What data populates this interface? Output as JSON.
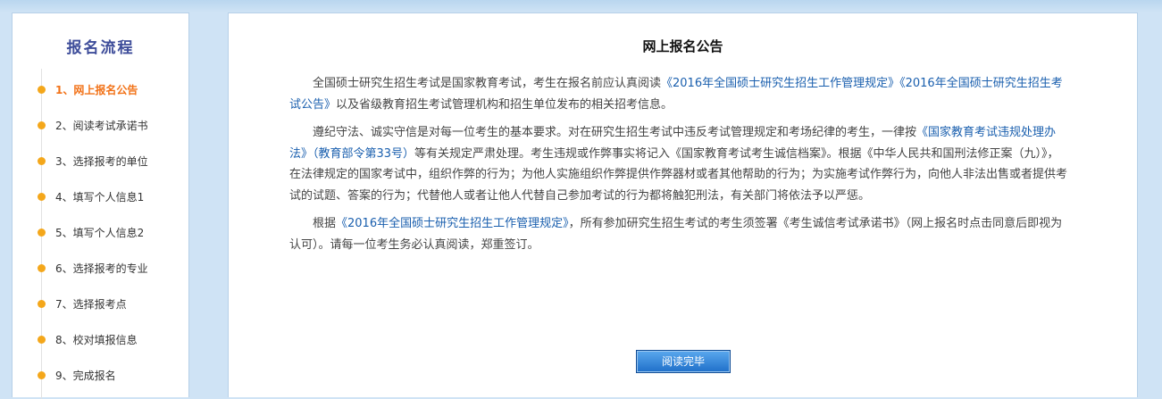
{
  "sidebar": {
    "title": "报名流程",
    "steps": [
      {
        "label": "1、网上报名公告",
        "active": true
      },
      {
        "label": "2、阅读考试承诺书",
        "active": false
      },
      {
        "label": "3、选择报考的单位",
        "active": false
      },
      {
        "label": "4、填写个人信息1",
        "active": false
      },
      {
        "label": "5、填写个人信息2",
        "active": false
      },
      {
        "label": "6、选择报考的专业",
        "active": false
      },
      {
        "label": "7、选择报考点",
        "active": false
      },
      {
        "label": "8、校对填报信息",
        "active": false
      },
      {
        "label": "9、完成报名",
        "active": false
      }
    ]
  },
  "notice": {
    "title": "网上报名公告",
    "p1": {
      "t1": "全国硕士研究生招生考试是国家教育考试，考生在报名前应认真阅读",
      "link1": "《2016年全国硕士研究生招生工作管理规定》",
      "link2": "《2016年全国硕士研究生招生考试公告》",
      "t2": "以及省级教育招生考试管理机构和招生单位发布的相关招考信息。"
    },
    "p2": {
      "t1": "遵纪守法、诚实守信是对每一位考生的基本要求。对在研究生招生考试中违反考试管理规定和考场纪律的考生，一律按",
      "link1": "《国家教育考试违规处理办法》（教育部令第33号）",
      "t2": "等有关规定严肃处理。考生违规或作弊事实将记入《国家教育考试考生诚信档案》。根据《中华人民共和国刑法修正案（九）》，在法律规定的国家考试中，组织作弊的行为；为他人实施组织作弊提供作弊器材或者其他帮助的行为；为实施考试作弊行为，向他人非法出售或者提供考试的试题、答案的行为；代替他人或者让他人代替自己参加考试的行为都将触犯刑法，有关部门将依法予以严惩。"
    },
    "p3": {
      "t1": "根据",
      "link1": "《2016年全国硕士研究生招生工作管理规定》",
      "t2": "，所有参加研究生招生考试的考生须签署《考生诚信考试承诺书》（网上报名时点击同意后即视为认可）。请每一位考生务必认真阅读，郑重签订。"
    },
    "button_label": "阅读完毕"
  },
  "colors": {
    "accent": "#f27218",
    "title": "#3e4d9a",
    "link": "#1a5fae",
    "dot": "#f4a71b"
  }
}
